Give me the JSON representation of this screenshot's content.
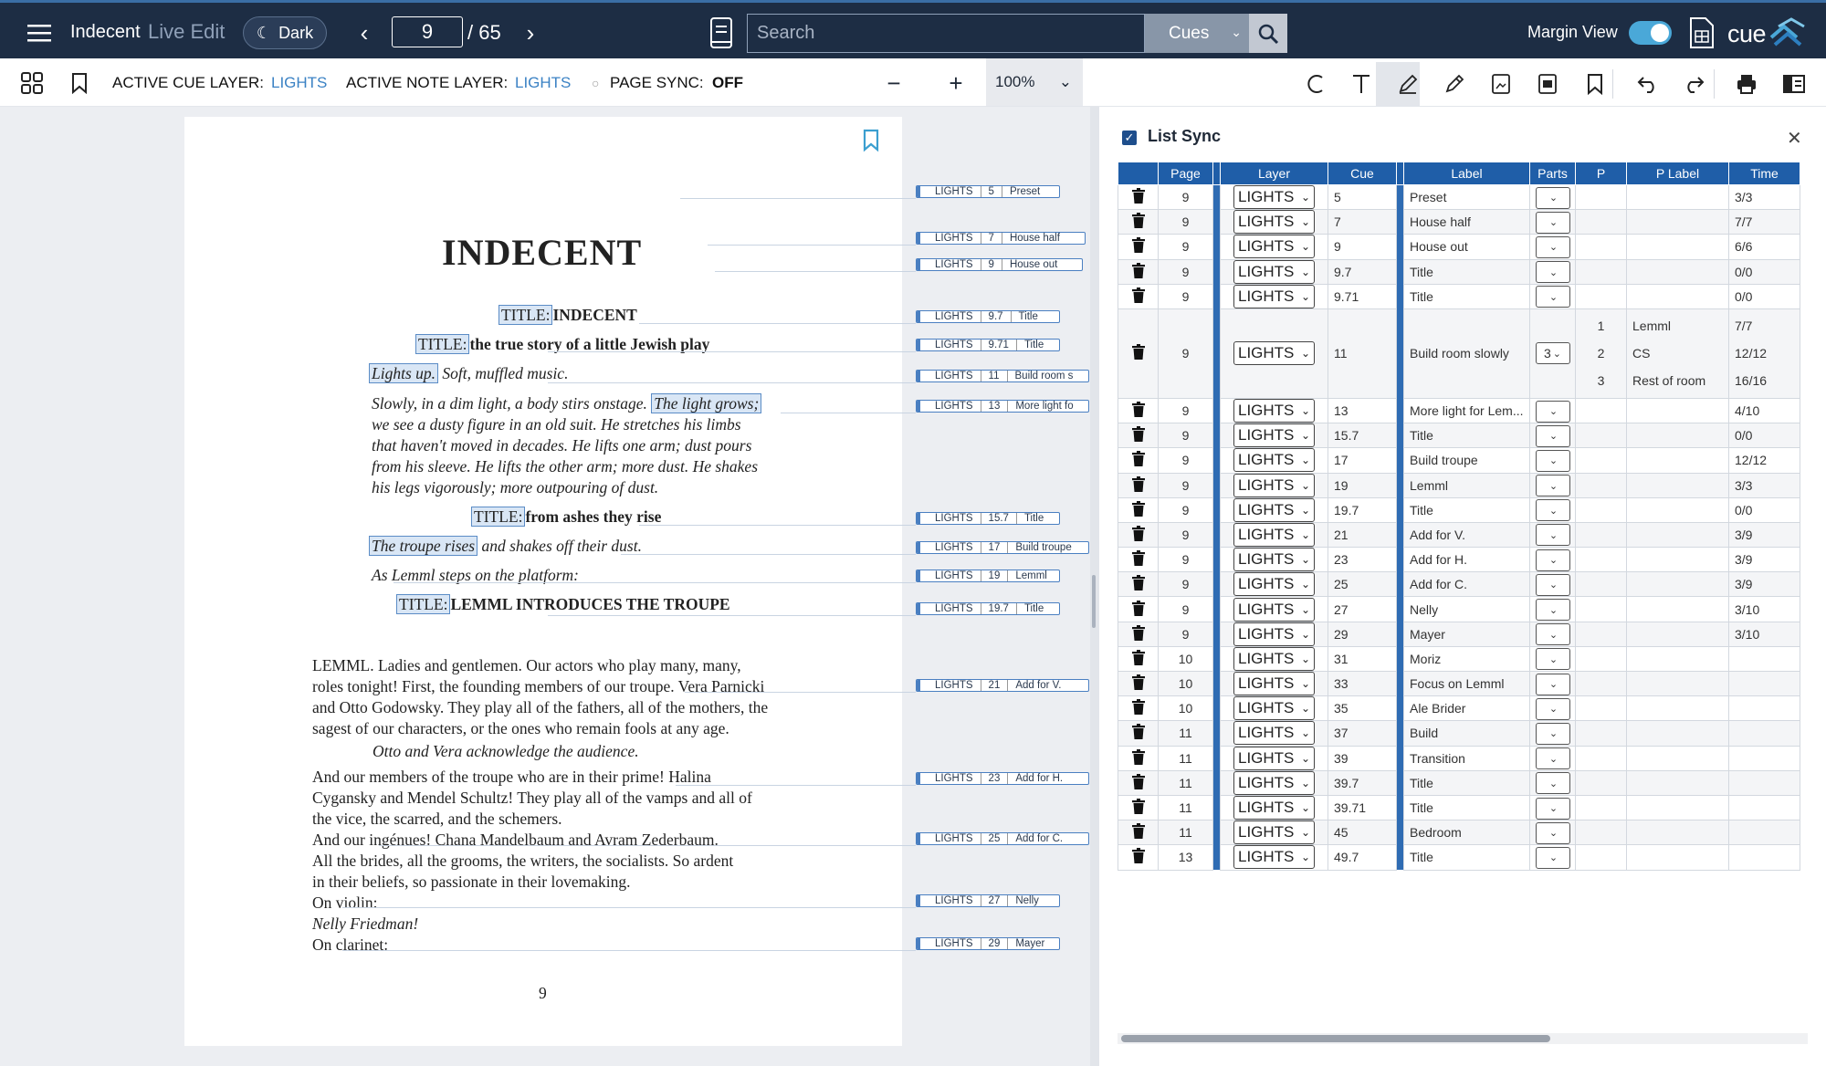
{
  "topbar": {
    "app_title": "Indecent",
    "mode": "Live Edit",
    "theme_button": "Dark",
    "page_current": "9",
    "page_total": "/ 65",
    "search_placeholder": "Search",
    "search_filter": "Cues",
    "margin_view_label": "Margin View",
    "margin_view_on": true,
    "logo_text": "cue"
  },
  "toolbar": {
    "active_cue_layer_label": "ACTIVE CUE LAYER:",
    "active_cue_layer_value": "LIGHTS",
    "active_note_layer_label": "ACTIVE NOTE LAYER:",
    "active_note_layer_value": "LIGHTS",
    "page_sync_label": "PAGE SYNC:",
    "page_sync_value": "OFF",
    "zoom": "100%",
    "tools": [
      "circle-tool-icon",
      "text-tool-icon",
      "highlighter-icon",
      "pen-icon",
      "image-icon",
      "photo-icon",
      "bookmark-icon",
      "undo-icon",
      "redo-icon",
      "print-icon",
      "panel-icon"
    ]
  },
  "script": {
    "title": "INDECENT",
    "page_number": "9",
    "lines": {
      "l1_hl": "TITLE:",
      "l1": "INDECENT",
      "l2_hl": "TITLE:",
      "l2": "the true story of a little Jewish play",
      "l3_hl": "Lights up.",
      "l3": " Soft, muffled music.",
      "l4a": "Slowly, in a dim light, a body stirs onstage. ",
      "l4_hl": "The light grows;",
      "l5": "we see a dusty figure in an old suit. He stretches his limbs",
      "l6": "that haven't moved in decades. He lifts one arm; dust pours",
      "l7": "from his sleeve. He lifts the other arm; more dust. He shakes",
      "l8": "his legs vigorously; more outpouring of dust.",
      "l9_hl": "TITLE:",
      "l9": "from ashes they rise",
      "l10_hl": "The troupe rises",
      "l10": " and shakes off their dust.",
      "l11": "As Lemml steps on the platform:",
      "l12_hl": "TITLE:",
      "l12": "LEMML INTRODUCES THE TROUPE",
      "l13": "LEMML.  Ladies and gentlemen. Our actors who play many, many,",
      "l14": "roles tonight! First, the founding members of our troupe. Vera Parnicki",
      "l15": "and Otto Godowsky. They play all of the fathers, all of the mothers, the",
      "l16": "sagest of our characters, or the ones who remain fools at any age.",
      "l17": "Otto and Vera acknowledge the audience.",
      "l18": "And our members of the troupe who are in their prime! Halina",
      "l19": "Cygansky and Mendel Schultz! They play all of the vamps and all of",
      "l20": "the vice, the scarred, and the schemers.",
      "l21": "And our ingénues! Chana Mandelbaum and Avram Zederbaum.",
      "l22": "All the brides, all the grooms, the writers, the socialists. So ardent",
      "l23": "in their beliefs, so passionate in their lovemaking.",
      "l24": "On violin:",
      "l25": "Nelly Friedman!",
      "l26": "On clarinet:"
    },
    "margin_tags": [
      {
        "layer": "LIGHTS",
        "cue": "5",
        "label": "Preset"
      },
      {
        "layer": "LIGHTS",
        "cue": "7",
        "label": "House half"
      },
      {
        "layer": "LIGHTS",
        "cue": "9",
        "label": "House out"
      },
      {
        "layer": "LIGHTS",
        "cue": "9.7",
        "label": "Title"
      },
      {
        "layer": "LIGHTS",
        "cue": "9.71",
        "label": "Title"
      },
      {
        "layer": "LIGHTS",
        "cue": "11",
        "label": "Build room s"
      },
      {
        "layer": "LIGHTS",
        "cue": "13",
        "label": "More light fo"
      },
      {
        "layer": "LIGHTS",
        "cue": "15.7",
        "label": "Title"
      },
      {
        "layer": "LIGHTS",
        "cue": "17",
        "label": "Build troupe"
      },
      {
        "layer": "LIGHTS",
        "cue": "19",
        "label": "Lemml"
      },
      {
        "layer": "LIGHTS",
        "cue": "19.7",
        "label": "Title"
      },
      {
        "layer": "LIGHTS",
        "cue": "21",
        "label": "Add for V."
      },
      {
        "layer": "LIGHTS",
        "cue": "23",
        "label": "Add for H."
      },
      {
        "layer": "LIGHTS",
        "cue": "25",
        "label": "Add for C."
      },
      {
        "layer": "LIGHTS",
        "cue": "27",
        "label": "Nelly"
      },
      {
        "layer": "LIGHTS",
        "cue": "29",
        "label": "Mayer"
      }
    ]
  },
  "list_sync": {
    "title": "List Sync",
    "checked": true,
    "columns": [
      "Page",
      "Layer",
      "Cue",
      "Label",
      "Parts",
      "P",
      "P Label",
      "Time"
    ],
    "rows": [
      {
        "page": "9",
        "layer": "LIGHTS",
        "cue": "5",
        "label": "Preset",
        "time": "3/3"
      },
      {
        "page": "9",
        "layer": "LIGHTS",
        "cue": "7",
        "label": "House half",
        "time": "7/7"
      },
      {
        "page": "9",
        "layer": "LIGHTS",
        "cue": "9",
        "label": "House out",
        "time": "6/6"
      },
      {
        "page": "9",
        "layer": "LIGHTS",
        "cue": "9.7",
        "label": "Title",
        "time": "0/0"
      },
      {
        "page": "9",
        "layer": "LIGHTS",
        "cue": "9.71",
        "label": "Title",
        "time": "0/0"
      },
      {
        "page": "9",
        "layer": "LIGHTS",
        "cue": "11",
        "label": "Build room slowly",
        "parts": "3",
        "subparts": [
          {
            "p": "1",
            "plabel": "Lemml",
            "time": "7/7"
          },
          {
            "p": "2",
            "plabel": "CS",
            "time": "12/12"
          },
          {
            "p": "3",
            "plabel": "Rest of room",
            "time": "16/16"
          }
        ]
      },
      {
        "page": "9",
        "layer": "LIGHTS",
        "cue": "13",
        "label": "More light for Lem...",
        "time": "4/10"
      },
      {
        "page": "9",
        "layer": "LIGHTS",
        "cue": "15.7",
        "label": "Title",
        "time": "0/0"
      },
      {
        "page": "9",
        "layer": "LIGHTS",
        "cue": "17",
        "label": "Build troupe",
        "time": "12/12"
      },
      {
        "page": "9",
        "layer": "LIGHTS",
        "cue": "19",
        "label": "Lemml",
        "time": "3/3"
      },
      {
        "page": "9",
        "layer": "LIGHTS",
        "cue": "19.7",
        "label": "Title",
        "time": "0/0"
      },
      {
        "page": "9",
        "layer": "LIGHTS",
        "cue": "21",
        "label": "Add for V.",
        "time": "3/9"
      },
      {
        "page": "9",
        "layer": "LIGHTS",
        "cue": "23",
        "label": "Add for H.",
        "time": "3/9"
      },
      {
        "page": "9",
        "layer": "LIGHTS",
        "cue": "25",
        "label": "Add for C.",
        "time": "3/9"
      },
      {
        "page": "9",
        "layer": "LIGHTS",
        "cue": "27",
        "label": "Nelly",
        "time": "3/10"
      },
      {
        "page": "9",
        "layer": "LIGHTS",
        "cue": "29",
        "label": "Mayer",
        "time": "3/10"
      },
      {
        "page": "10",
        "layer": "LIGHTS",
        "cue": "31",
        "label": "Moriz",
        "time": ""
      },
      {
        "page": "10",
        "layer": "LIGHTS",
        "cue": "33",
        "label": "Focus on Lemml",
        "time": ""
      },
      {
        "page": "10",
        "layer": "LIGHTS",
        "cue": "35",
        "label": "Ale Brider",
        "time": ""
      },
      {
        "page": "11",
        "layer": "LIGHTS",
        "cue": "37",
        "label": "Build",
        "time": ""
      },
      {
        "page": "11",
        "layer": "LIGHTS",
        "cue": "39",
        "label": "Transition",
        "time": ""
      },
      {
        "page": "11",
        "layer": "LIGHTS",
        "cue": "39.7",
        "label": "Title",
        "time": ""
      },
      {
        "page": "11",
        "layer": "LIGHTS",
        "cue": "39.71",
        "label": "Title",
        "time": ""
      },
      {
        "page": "11",
        "layer": "LIGHTS",
        "cue": "45",
        "label": "Bedroom",
        "time": ""
      },
      {
        "page": "13",
        "layer": "LIGHTS",
        "cue": "49.7",
        "label": "Title",
        "time": ""
      }
    ]
  }
}
